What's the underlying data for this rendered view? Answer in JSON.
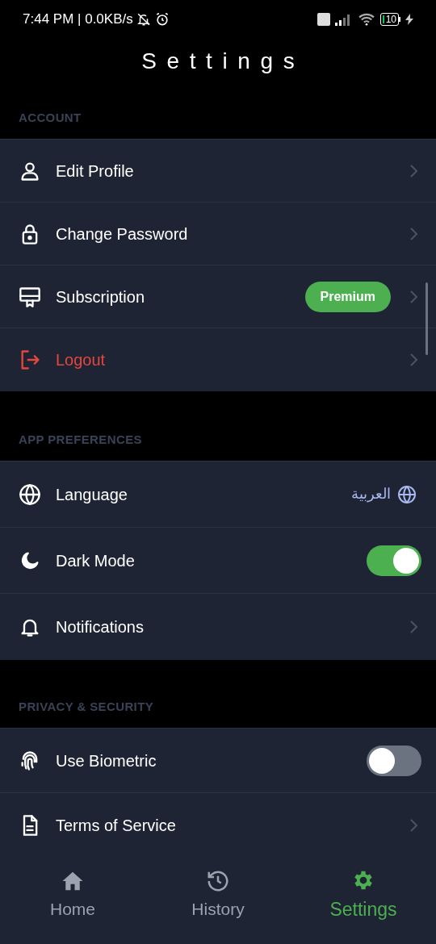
{
  "status_bar": {
    "time": "7:44 PM | 0.0KB/s",
    "battery": "10"
  },
  "header": {
    "title": "Settings"
  },
  "sections": [
    {
      "title": "ACCOUNT",
      "items": [
        {
          "kind": "link",
          "label": "Edit Profile",
          "danger": false
        },
        {
          "kind": "link",
          "label": "Change Password",
          "danger": false
        },
        {
          "kind": "badge",
          "label": "Subscription",
          "badge": "Premium",
          "danger": false
        },
        {
          "kind": "link",
          "label": "Logout",
          "danger": true
        }
      ]
    },
    {
      "title": "APP PREFERENCES",
      "items": [
        {
          "kind": "value",
          "label": "Language",
          "value": "العربية"
        },
        {
          "kind": "toggle",
          "label": "Dark Mode",
          "on": true
        },
        {
          "kind": "link",
          "label": "Notifications",
          "danger": false
        }
      ]
    },
    {
      "title": "PRIVACY & SECURITY",
      "items": [
        {
          "kind": "toggle",
          "label": "Use Biometric",
          "on": false
        },
        {
          "kind": "link",
          "label": "Terms of Service",
          "danger": false
        }
      ]
    }
  ],
  "bottom_nav": [
    {
      "label": "Home",
      "selected": false
    },
    {
      "label": "History",
      "selected": false
    },
    {
      "label": "Settings",
      "selected": true
    }
  ]
}
